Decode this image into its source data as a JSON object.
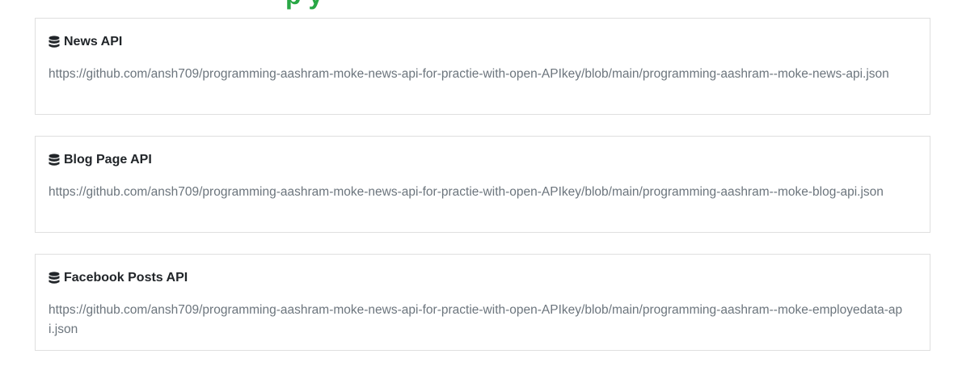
{
  "page": {
    "heading_fragment": "p y"
  },
  "apis": [
    {
      "title": "News API",
      "icon": "database-icon",
      "url": "https://github.com/ansh709/programming-aashram-moke-news-api-for-practie-with-open-APIkey/blob/main/programming-aashram--moke-news-api.json"
    },
    {
      "title": "Blog Page API",
      "icon": "database-icon",
      "url": "https://github.com/ansh709/programming-aashram-moke-news-api-for-practie-with-open-APIkey/blob/main/programming-aashram--moke-blog-api.json"
    },
    {
      "title": "Facebook Posts API",
      "icon": "database-icon",
      "url": "https://github.com/ansh709/programming-aashram-moke-news-api-for-practie-with-open-APIkey/blob/main/programming-aashram--moke-employedata-api.json"
    }
  ],
  "colors": {
    "heading": "#28a745",
    "title": "#212529",
    "link": "#6c757d",
    "border": "#dfdfdf"
  }
}
